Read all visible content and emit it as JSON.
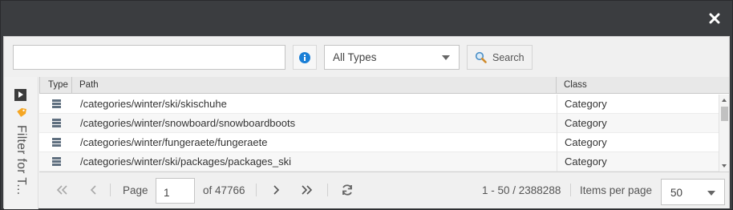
{
  "dialog": {
    "close_icon": "close-icon"
  },
  "toolbar": {
    "search_value": "",
    "search_placeholder": "",
    "info_icon": "info-icon",
    "type_filter": {
      "selected": "All Types"
    },
    "search_button": {
      "label": "Search",
      "icon": "magnifier-icon"
    }
  },
  "side_panel": {
    "expand_icon": "play-icon",
    "tag_icon": "tag-icon",
    "label": "Filter for T..."
  },
  "grid": {
    "columns": {
      "type": "Type",
      "path": "Path",
      "class": "Class"
    },
    "rows": [
      {
        "icon": "object-icon",
        "path": "/categories/winter/ski/skischuhe",
        "class": "Category"
      },
      {
        "icon": "object-icon",
        "path": "/categories/winter/snowboard/snowboardboots",
        "class": "Category"
      },
      {
        "icon": "object-icon",
        "path": "/categories/winter/fungeraete/fungeraete",
        "class": "Category"
      },
      {
        "icon": "object-icon",
        "path": "/categories/winter/ski/packages/packages_ski",
        "class": "Category"
      }
    ]
  },
  "pager": {
    "page_label": "Page",
    "current_page": "1",
    "total_pages_text": "of 47766",
    "range_text": "1 - 50 / 2388288",
    "items_per_page_label": "Items per page",
    "items_per_page_value": "50"
  },
  "colors": {
    "titlebar": "#3b3d40",
    "info_blue": "#1a7fd6",
    "tag_orange": "#f5a623"
  }
}
